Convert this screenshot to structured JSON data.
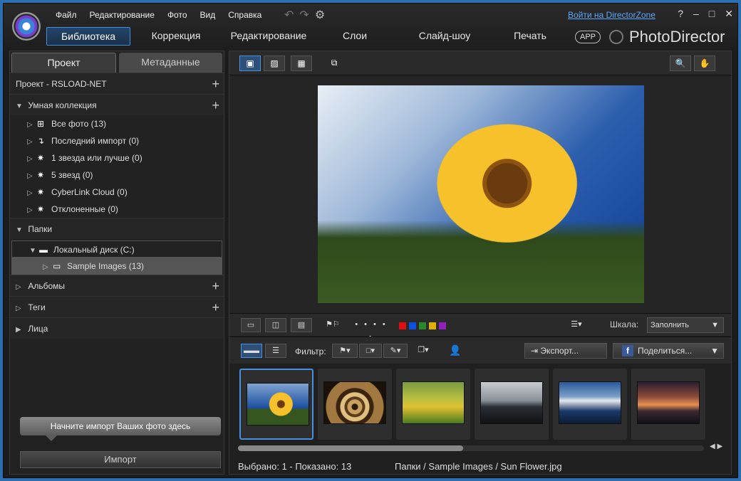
{
  "menu": [
    "Файл",
    "Редактирование",
    "Фото",
    "Вид",
    "Справка"
  ],
  "toolbar_icons": [
    "undo-icon",
    "redo-icon",
    "settings-icon"
  ],
  "login_link": "Войти на DirectorZone",
  "window_controls": [
    "?",
    "–",
    "□",
    "✕"
  ],
  "modes": [
    {
      "label": "Библиотека",
      "active": true
    },
    {
      "label": "Коррекция",
      "active": false
    },
    {
      "label": "Редактирование",
      "active": false
    },
    {
      "label": "Слои",
      "active": false
    },
    {
      "label": "Слайд-шоу",
      "active": false
    },
    {
      "label": "Печать",
      "active": false
    }
  ],
  "app_button": "APP",
  "brand": "PhotoDirector",
  "left_tabs": [
    "Проект",
    "Метаданные"
  ],
  "project_title": "Проект - RSLOAD-NET",
  "smart_collection": {
    "title": "Умная коллекция",
    "items": [
      "Все фото (13)",
      "Последний импорт (0)",
      "1 звезда или лучше (0)",
      "5 звезд (0)",
      "CyberLink Cloud (0)",
      "Отклоненные (0)"
    ]
  },
  "folders": {
    "title": "Папки",
    "disk": "Локальный диск (C:)",
    "folder": "Sample Images (13)"
  },
  "albums": "Альбомы",
  "tags": "Теги",
  "faces": "Лица",
  "import_tip": "Начните импорт Ваших фото здесь",
  "import_button": "Импорт",
  "scale_label": "Шкала:",
  "scale_value": "Заполнить",
  "filter_label": "Фильтр:",
  "export_button": "Экспорт...",
  "share_button": "Поделиться...",
  "color_labels": [
    "#e01010",
    "#1050e0",
    "#2a8a2a",
    "#e0b000",
    "#9020c0"
  ],
  "status": "Выбрано: 1 - Показано: 13",
  "path": "Папки / Sample Images / Sun Flower.jpg",
  "scroll_position": 0.48
}
